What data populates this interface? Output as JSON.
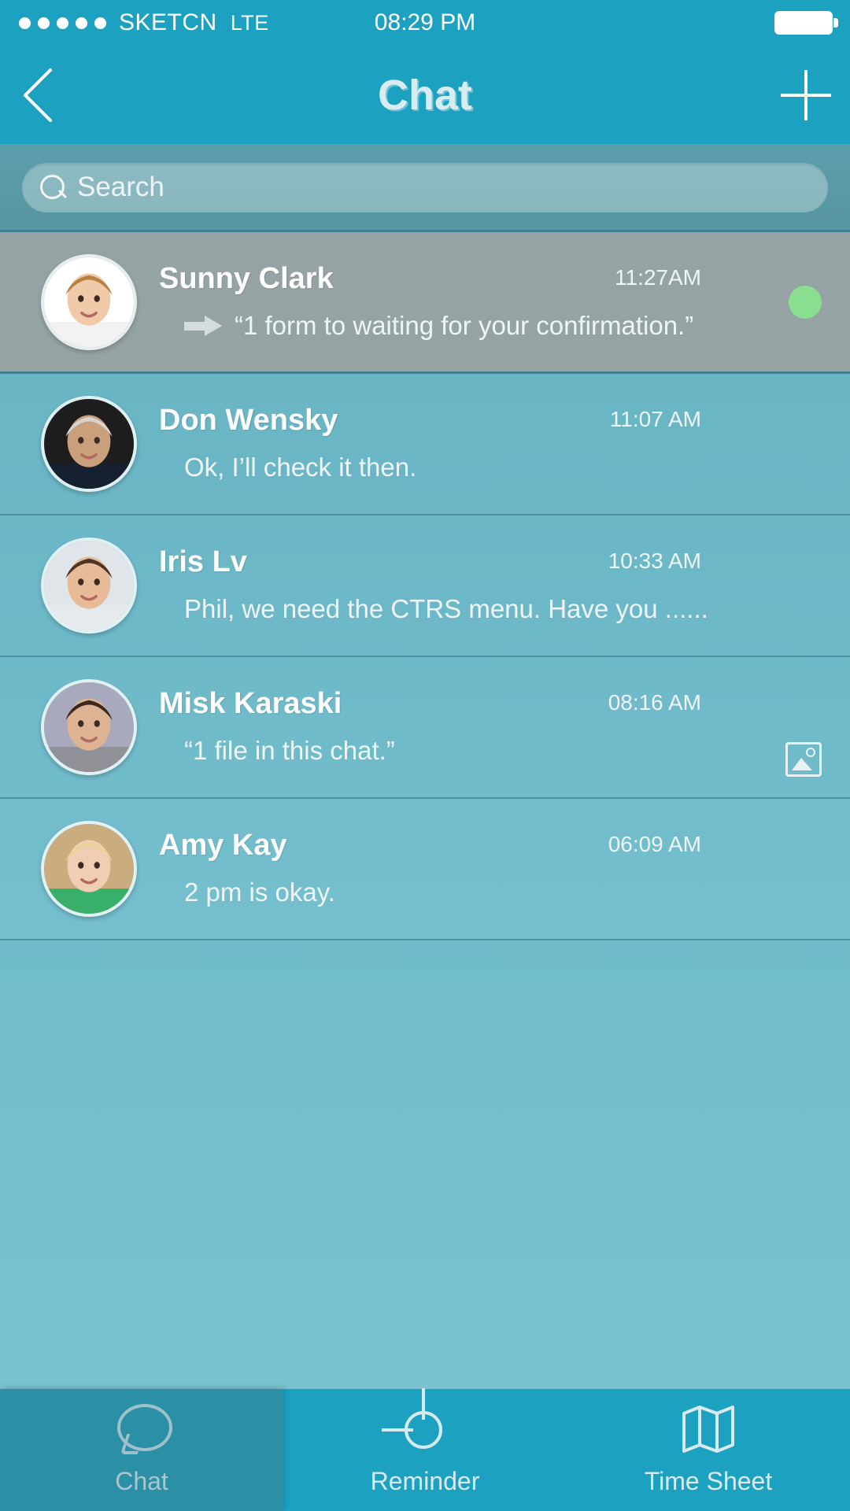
{
  "status_bar": {
    "signal_dots": 5,
    "carrier": "SKETCN",
    "network": "LTE",
    "time": "08:29 PM",
    "battery_icon": "battery-full-icon"
  },
  "nav_bar": {
    "back_icon": "chevron-left-icon",
    "title": "Chat",
    "add_icon": "plus-icon"
  },
  "search": {
    "icon": "search-icon",
    "placeholder": "Search",
    "value": ""
  },
  "colors": {
    "brand": "#1ca2c0",
    "selected_row": "#96a3a5",
    "active_tab": "#2b8fa6",
    "online_dot": "#8ade8f",
    "text_light": "#eef5f6"
  },
  "chat_list": [
    {
      "name": "Sunny Clark",
      "time": "11:27AM",
      "preview": "“1 form to waiting for your confirmation.”",
      "selected": true,
      "prefix_icon": "arrow-right-icon",
      "status_dot": "online-dot",
      "attachment_icon": "",
      "avatar": "avatar-sunny-clark"
    },
    {
      "name": "Don Wensky",
      "time": "11:07 AM",
      "preview": "Ok, I’ll check it then.",
      "selected": false,
      "prefix_icon": "",
      "status_dot": "",
      "attachment_icon": "",
      "avatar": "avatar-don-wensky"
    },
    {
      "name": "Iris Lv",
      "time": "10:33 AM",
      "preview": "Phil, we need the CTRS menu. Have you ......",
      "selected": false,
      "prefix_icon": "",
      "status_dot": "",
      "attachment_icon": "",
      "avatar": "avatar-iris-lv"
    },
    {
      "name": "Misk Karaski",
      "time": "08:16 AM",
      "preview": "“1 file in this chat.”",
      "selected": false,
      "prefix_icon": "",
      "status_dot": "",
      "attachment_icon": "image-attachment-icon",
      "avatar": "avatar-misk-karaski"
    },
    {
      "name": "Amy Kay",
      "time": "06:09 AM",
      "preview": "2 pm is okay.",
      "selected": false,
      "prefix_icon": "",
      "status_dot": "",
      "attachment_icon": "",
      "avatar": "avatar-amy-kay"
    }
  ],
  "tab_bar": [
    {
      "label": "Chat",
      "icon": "chat-bubble-icon",
      "active": true
    },
    {
      "label": "Reminder",
      "icon": "target-icon",
      "active": false
    },
    {
      "label": "Time Sheet",
      "icon": "map-icon",
      "active": false
    }
  ]
}
